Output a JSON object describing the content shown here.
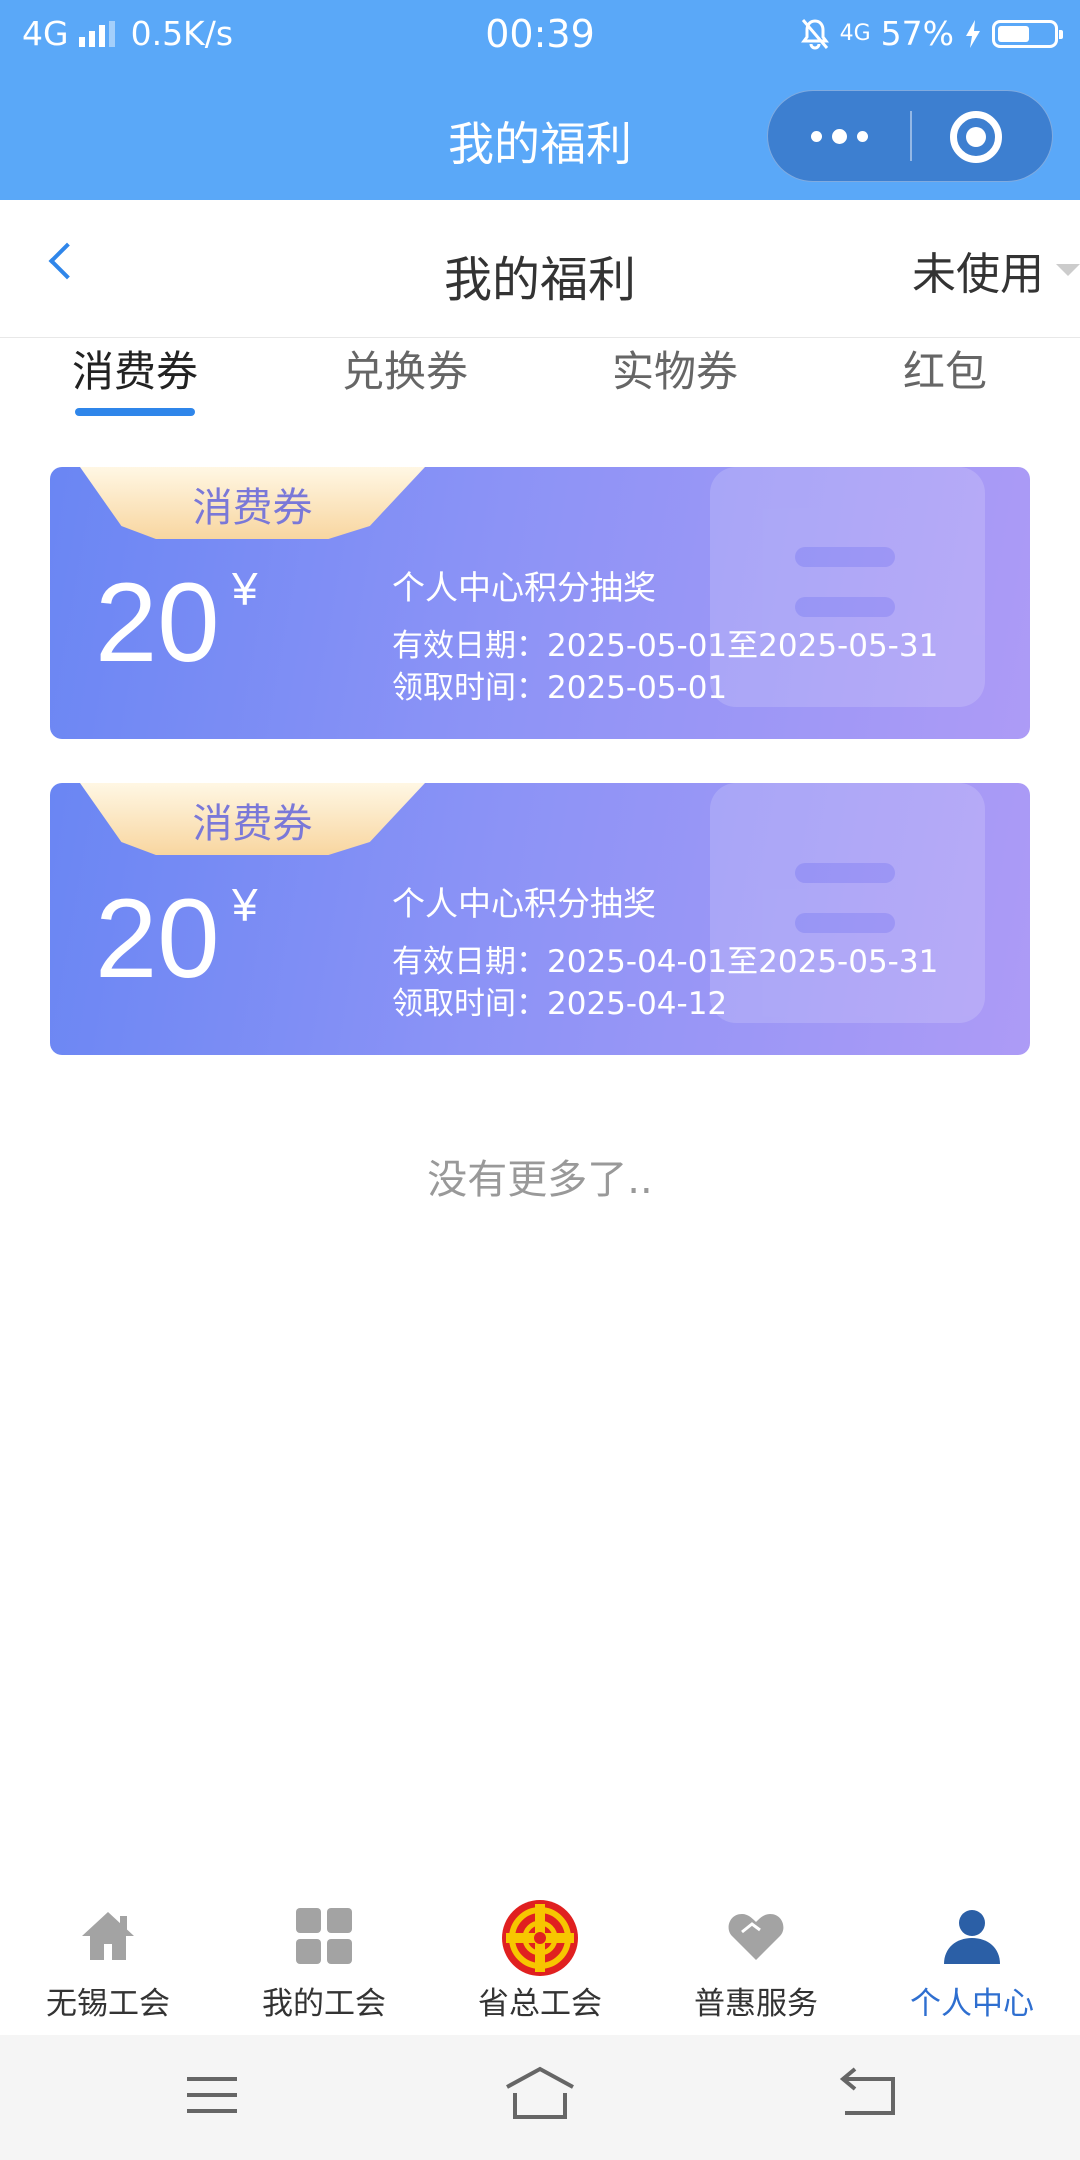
{
  "status_bar": {
    "network": "4G",
    "speed": "0.5K/s",
    "time": "00:39",
    "network_right": "4G",
    "battery": "57%",
    "battery_level": 0.57
  },
  "mini_program": {
    "title": "我的福利"
  },
  "header": {
    "title": "我的福利",
    "filter": "未使用"
  },
  "tabs": [
    {
      "label": "消费券",
      "active": true
    },
    {
      "label": "兑换券",
      "active": false
    },
    {
      "label": "实物券",
      "active": false
    },
    {
      "label": "红包",
      "active": false
    }
  ],
  "coupons": [
    {
      "badge": "消费券",
      "amount": "20",
      "currency": "¥",
      "name": "个人中心积分抽奖",
      "valid": "有效日期：2025-05-01至2025-05-31",
      "received": "领取时间：2025-05-01"
    },
    {
      "badge": "消费券",
      "amount": "20",
      "currency": "¥",
      "name": "个人中心积分抽奖",
      "valid": "有效日期：2025-04-01至2025-05-31",
      "received": "领取时间：2025-04-12"
    }
  ],
  "no_more": "没有更多了..",
  "tabbar": [
    {
      "label": "无锡工会",
      "icon": "home-icon",
      "active": false
    },
    {
      "label": "我的工会",
      "icon": "grid-icon",
      "active": false
    },
    {
      "label": "省总工会",
      "icon": "union-emblem-icon",
      "active": false
    },
    {
      "label": "普惠服务",
      "icon": "heart-icon",
      "active": false
    },
    {
      "label": "个人中心",
      "icon": "person-icon",
      "active": true
    }
  ],
  "colors": {
    "status_bar": "#5aa8f8",
    "accent": "#2f86ea",
    "coupon_gradient_start": "#6a86f3",
    "coupon_gradient_end": "#ad9bf6",
    "badge_gold": "#f8d6a0",
    "tab_active": "#2f6fd0"
  }
}
